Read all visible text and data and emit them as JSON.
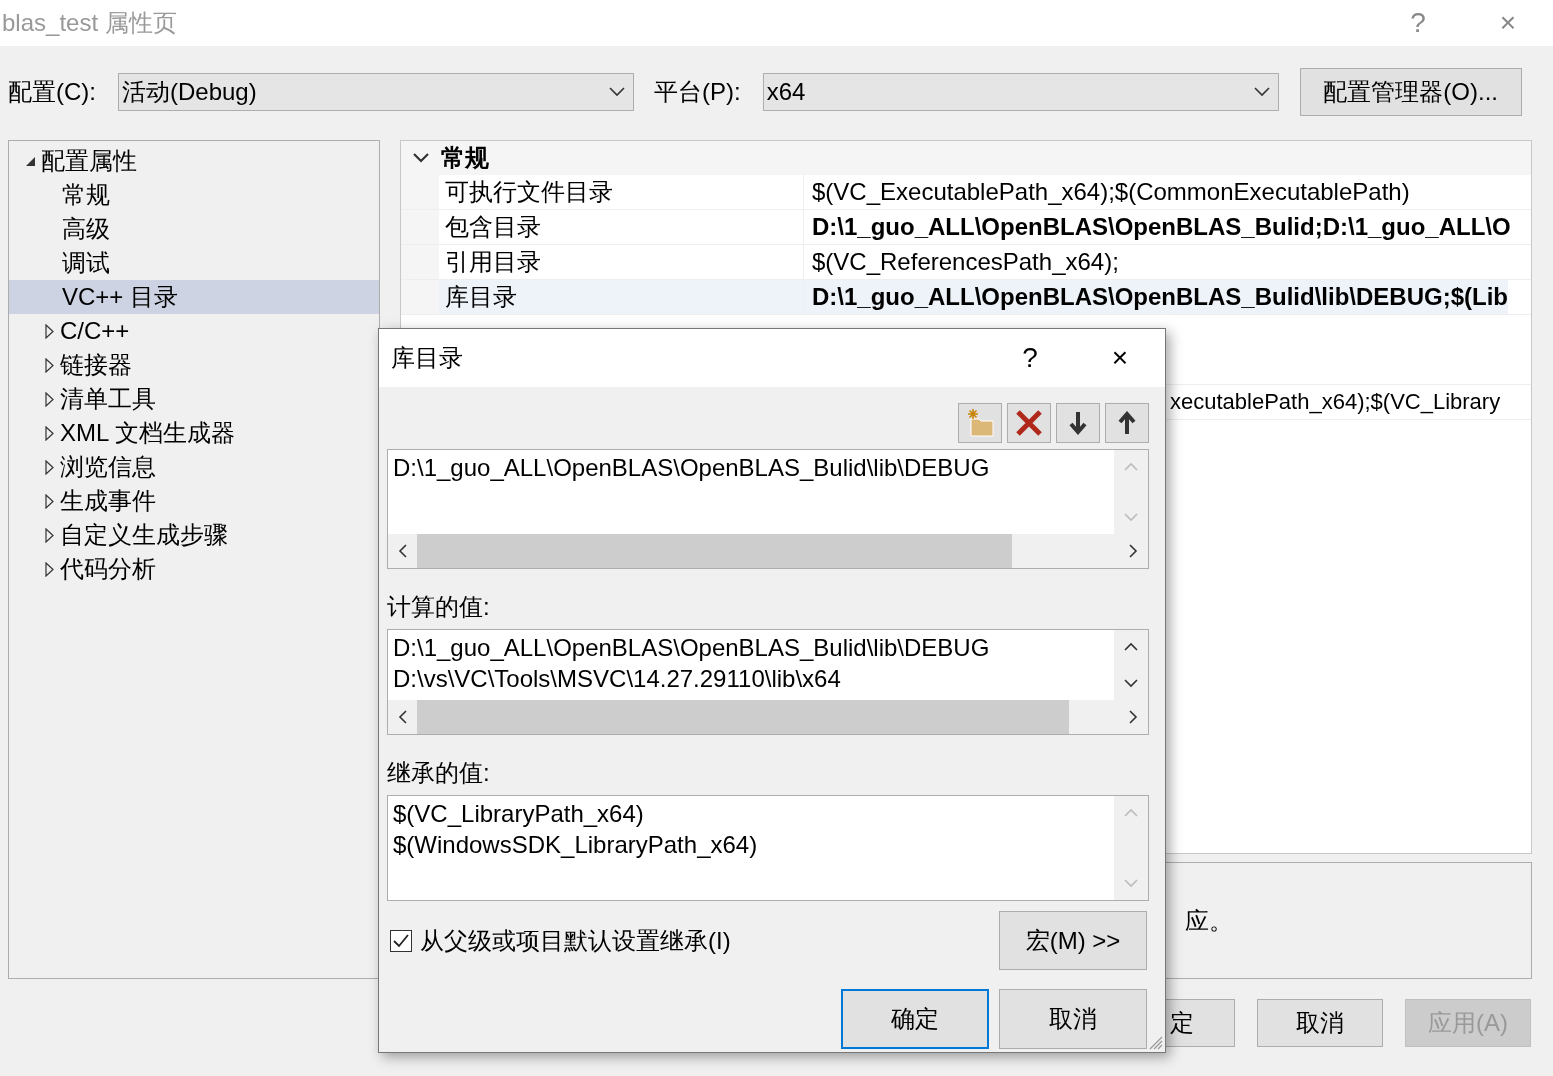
{
  "window": {
    "title": "blas_test 属性页",
    "help": "?",
    "close": "×"
  },
  "config": {
    "label": "配置(C):",
    "value": "活动(Debug)"
  },
  "platform": {
    "label": "平台(P):",
    "value": "x64"
  },
  "config_manager": "配置管理器(O)...",
  "tree": [
    {
      "label": "配置属性",
      "expanded": true,
      "selected": false,
      "children": [
        {
          "label": "常规",
          "selected": false
        },
        {
          "label": "高级",
          "selected": false
        },
        {
          "label": "调试",
          "selected": false
        },
        {
          "label": "VC++ 目录",
          "selected": true
        }
      ]
    },
    {
      "label": "C/C++",
      "expanded": false,
      "selected": false
    },
    {
      "label": "链接器",
      "expanded": false,
      "selected": false
    },
    {
      "label": "清单工具",
      "expanded": false,
      "selected": false
    },
    {
      "label": "XML 文档生成器",
      "expanded": false,
      "selected": false
    },
    {
      "label": "浏览信息",
      "expanded": false,
      "selected": false
    },
    {
      "label": "生成事件",
      "expanded": false,
      "selected": false
    },
    {
      "label": "自定义生成步骤",
      "expanded": false,
      "selected": false
    },
    {
      "label": "代码分析",
      "expanded": false,
      "selected": false
    }
  ],
  "grid": {
    "section": "常规",
    "expanded": true,
    "rows": [
      {
        "kind": "full",
        "name": "可执行文件目录",
        "value": "$(VC_ExecutablePath_x64);$(CommonExecutablePath)",
        "bold": false,
        "selected": false
      },
      {
        "kind": "full",
        "name": "包含目录",
        "value": "D:\\1_guo_ALL\\OpenBLAS\\OpenBLAS_Bulid;D:\\1_guo_ALL\\O",
        "bold": true,
        "selected": false
      },
      {
        "kind": "full",
        "name": "引用目录",
        "value": "$(VC_ReferencesPath_x64);",
        "bold": false,
        "selected": false
      },
      {
        "kind": "full",
        "name": "库目录",
        "value": "D:\\1_guo_ALL\\OpenBLAS\\OpenBLAS_Bulid\\lib\\DEBUG;$(Lib",
        "bold": true,
        "selected": true
      },
      {
        "kind": "partial",
        "value": "xecutablePath_x64);$(VC_Library",
        "bold": false,
        "selected": false
      }
    ]
  },
  "description": "应。",
  "buttons": [
    {
      "label": "定",
      "kind": "partial",
      "disabled": false
    },
    {
      "label": "取消",
      "kind": "full",
      "disabled": false
    },
    {
      "label": "应用(A)",
      "kind": "full",
      "disabled": true
    }
  ],
  "dialog": {
    "title": "库目录",
    "help": "?",
    "close": "×",
    "entries": [
      "D:\\1_guo_ALL\\OpenBLAS\\OpenBLAS_Bulid\\lib\\DEBUG"
    ],
    "evaluated_label": "计算的值:",
    "evaluated": [
      "D:\\1_guo_ALL\\OpenBLAS\\OpenBLAS_Bulid\\lib\\DEBUG",
      "D:\\vs\\VC\\Tools\\MSVC\\14.27.29110\\lib\\x64"
    ],
    "inherited_label": "继承的值:",
    "inherited": [
      "$(VC_LibraryPath_x64)",
      "$(WindowsSDK_LibraryPath_x64)"
    ],
    "inherit_checkbox": {
      "label": "从父级或项目默认设置继承(I)",
      "checked": true
    },
    "macros_button": "宏(M) >>",
    "ok": "确定",
    "cancel": "取消"
  }
}
